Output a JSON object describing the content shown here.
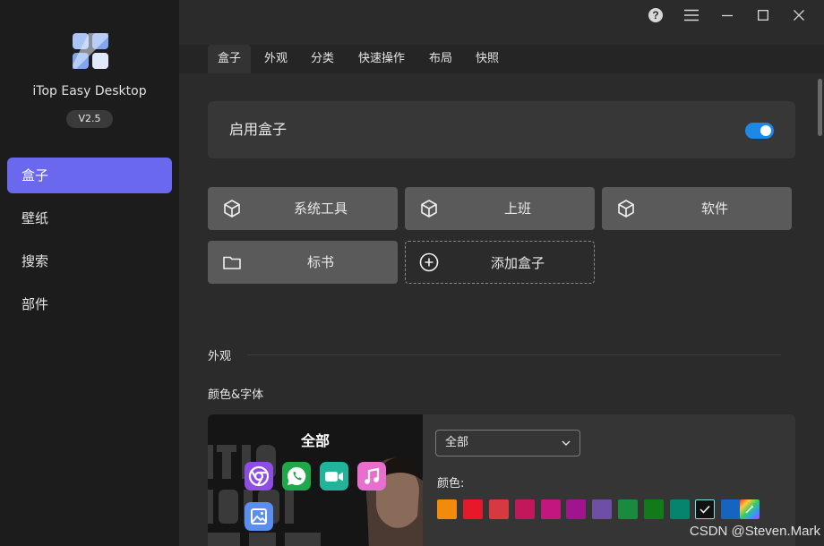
{
  "app": {
    "name": "iTop Easy Desktop",
    "version": "V2.5"
  },
  "sidebar": {
    "items": [
      {
        "label": "盒子",
        "active": true
      },
      {
        "label": "壁纸",
        "active": false
      },
      {
        "label": "搜索",
        "active": false
      },
      {
        "label": "部件",
        "active": false
      }
    ]
  },
  "window_controls": [
    "help-icon",
    "menu-icon",
    "minimize-icon",
    "maximize-icon",
    "close-icon"
  ],
  "tabs": [
    {
      "label": "盒子",
      "active": true
    },
    {
      "label": "外观",
      "active": false
    },
    {
      "label": "分类",
      "active": false
    },
    {
      "label": "快速操作",
      "active": false
    },
    {
      "label": "布局",
      "active": false
    },
    {
      "label": "快照",
      "active": false
    }
  ],
  "enable": {
    "label": "启用盒子",
    "on": true
  },
  "boxes": [
    {
      "label": "系统工具",
      "icon": "cube-icon"
    },
    {
      "label": "上班",
      "icon": "cube-icon"
    },
    {
      "label": "软件",
      "icon": "cube-icon"
    },
    {
      "label": "标书",
      "icon": "folder-icon"
    },
    {
      "label": "添加盒子",
      "icon": "plus-circle-icon"
    }
  ],
  "appearance": {
    "section_title": "外观",
    "subtitle": "颜色&字体",
    "preview_title": "全部",
    "select_value": "全部",
    "color_label": "颜色:",
    "colors": [
      "#f28b0c",
      "#e8182b",
      "#d6393f",
      "#c2185b",
      "#c2177f",
      "#a0148e",
      "#6f4fa6",
      "#1a8a3e",
      "#127a18",
      "#07846e",
      "#111111",
      "#1565c0",
      "rainbow"
    ],
    "selected_color_index": 10
  },
  "watermark": "CSDN @Steven.Mark"
}
